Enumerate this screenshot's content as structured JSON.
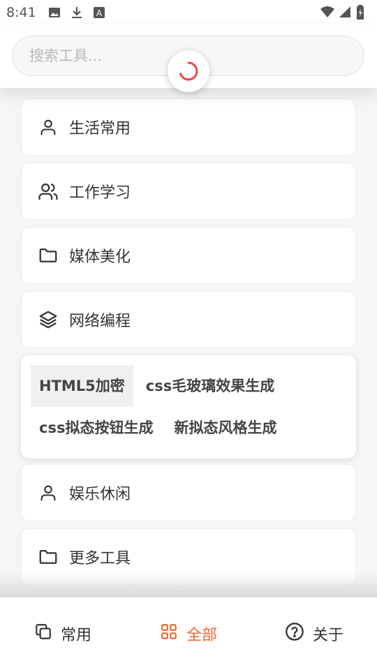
{
  "status": {
    "time": "8:41",
    "icons_left": [
      "image-icon",
      "download-icon",
      "text-icon"
    ],
    "icons_right": [
      "wifi-icon",
      "signal-icon",
      "battery-icon"
    ]
  },
  "search": {
    "placeholder": "搜索工具..."
  },
  "categories": [
    {
      "label": "生活常用",
      "icon": "user-icon"
    },
    {
      "label": "工作学习",
      "icon": "users-icon"
    },
    {
      "label": "媒体美化",
      "icon": "folder-icon"
    },
    {
      "label": "网络编程",
      "icon": "layers-icon"
    }
  ],
  "subtools": [
    "HTML5加密",
    "css毛玻璃效果生成",
    "css拟态按钮生成",
    "新拟态风格生成"
  ],
  "categories_after": [
    {
      "label": "娱乐休闲",
      "icon": "user-icon"
    },
    {
      "label": "更多工具",
      "icon": "folder-icon"
    }
  ],
  "nav": [
    {
      "label": "常用",
      "icon": "copy-icon"
    },
    {
      "label": "全部",
      "icon": "grid-icon"
    },
    {
      "label": "关于",
      "icon": "help-icon"
    }
  ],
  "colors": {
    "accent": "#f0652e",
    "spinner": "#f04545"
  }
}
